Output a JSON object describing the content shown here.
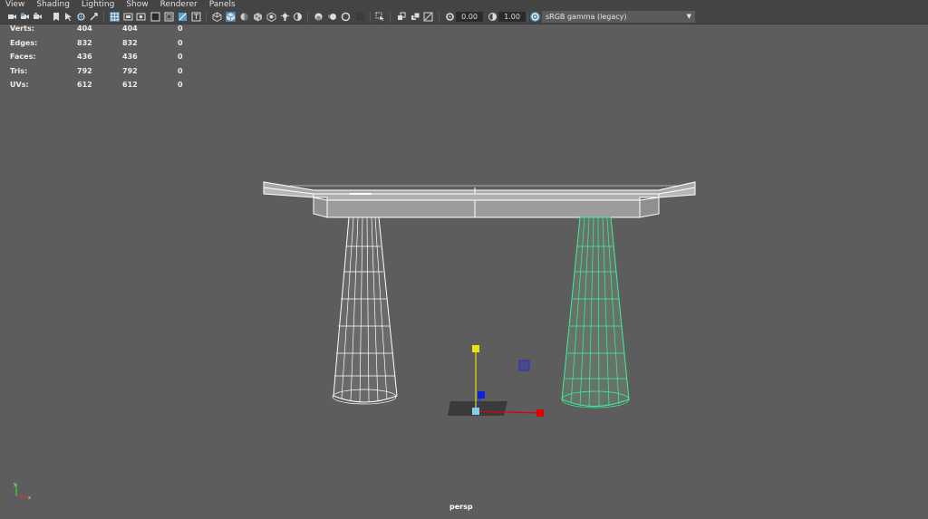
{
  "menubar": {
    "items": [
      "View",
      "Shading",
      "Lighting",
      "Show",
      "Renderer",
      "Panels"
    ]
  },
  "toolbar": {
    "icons": [
      "camera-icon",
      "camera-attributes-icon",
      "bookmark-icon",
      "image-plane-icon",
      "select-camera-icon",
      "grab-layout-icon",
      "2d-pan-icon",
      "grid-icon",
      "film-gate-icon",
      "resolution-gate-icon",
      "gate-mask-icon",
      "field-chart-icon",
      "safe-action-icon",
      "wireframe-icon",
      "smooth-shade-icon",
      "default-material-icon",
      "textured-icon",
      "lights-icon",
      "shadows-icon",
      "screen-space-ao-icon",
      "motion-blur-icon",
      "multisample-aa-icon",
      "depth-of-field-icon",
      "isolate-select-icon",
      "xray-icon",
      "xray-joints-icon",
      "xray-components-icon",
      "exposure-icon",
      "gamma-icon",
      "view-transform-icon"
    ],
    "exposure_value": "0.00",
    "gamma_value": "1.00",
    "colorspace": "sRGB gamma (legacy)"
  },
  "hud": {
    "rows": [
      {
        "label": "Verts:",
        "v1": "404",
        "v2": "404",
        "v3": "0"
      },
      {
        "label": "Edges:",
        "v1": "832",
        "v2": "832",
        "v3": "0"
      },
      {
        "label": "Faces:",
        "v1": "436",
        "v2": "436",
        "v3": "0"
      },
      {
        "label": "Tris:",
        "v1": "792",
        "v2": "792",
        "v3": "0"
      },
      {
        "label": "UVs:",
        "v1": "612",
        "v2": "612",
        "v3": "0"
      }
    ]
  },
  "viewport": {
    "camera_label": "persp",
    "background": "#5d5d5d",
    "selected_color": "#3ff0a0",
    "wire_color": "#ffffff"
  }
}
